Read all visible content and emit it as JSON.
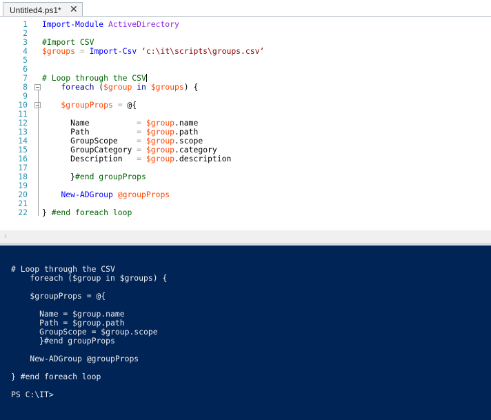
{
  "tab": {
    "title": "Untitled4.ps1*",
    "close_glyph": "✕"
  },
  "editor": {
    "lines": [
      {
        "n": "1",
        "code": "Import-Module ActiveDirectory"
      },
      {
        "n": "2",
        "code": ""
      },
      {
        "n": "3",
        "code": "#Import CSV"
      },
      {
        "n": "4",
        "code": "$groups = Import-Csv ‘c:\\it\\scripts\\groups.csv‘"
      },
      {
        "n": "5",
        "code": ""
      },
      {
        "n": "6",
        "code": ""
      },
      {
        "n": "7",
        "code": "# Loop through the CSV"
      },
      {
        "n": "8",
        "code": "    foreach ($group in $groups) {"
      },
      {
        "n": "9",
        "code": ""
      },
      {
        "n": "10",
        "code": "    $groupProps = @{"
      },
      {
        "n": "11",
        "code": ""
      },
      {
        "n": "12",
        "code": "      Name          = $group.name"
      },
      {
        "n": "13",
        "code": "      Path          = $group.path"
      },
      {
        "n": "14",
        "code": "      GroupScope    = $group.scope"
      },
      {
        "n": "15",
        "code": "      GroupCategory = $group.category"
      },
      {
        "n": "16",
        "code": "      Description   = $group.description"
      },
      {
        "n": "17",
        "code": ""
      },
      {
        "n": "18",
        "code": "      }#end groupProps"
      },
      {
        "n": "19",
        "code": ""
      },
      {
        "n": "20",
        "code": "    New-ADGroup @groupProps"
      },
      {
        "n": "21",
        "code": ""
      },
      {
        "n": "22",
        "code": "} #end foreach loop"
      }
    ]
  },
  "console": {
    "lines": [
      "# Loop through the CSV",
      "    foreach ($group in $groups) {",
      "",
      "    $groupProps = @{",
      "",
      "      Name = $group.name",
      "      Path = $group.path",
      "      GroupScope = $group.scope",
      "      }#end groupProps",
      "",
      "    New-ADGroup @groupProps",
      "",
      "} #end foreach loop",
      "",
      "PS C:\\IT>"
    ]
  },
  "colors": {
    "console_bg": "#012456",
    "line_number": "#2b91af"
  },
  "icons": {
    "scroll_left": "scroll-left-arrow-icon",
    "fold": "fold-collapse-icon"
  }
}
